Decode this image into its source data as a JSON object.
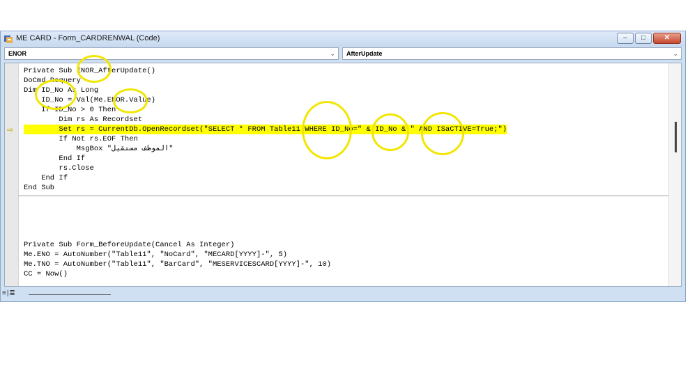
{
  "window": {
    "title": "ME CARD - Form_CARDRENWAL (Code)",
    "buttons": {
      "minimize": "–",
      "maximize": "□",
      "close": "✕"
    }
  },
  "combos": {
    "object": {
      "value": "ENOR",
      "arrow": "⌄"
    },
    "procedure": {
      "value": "AfterUpdate",
      "arrow": "⌄"
    }
  },
  "code_lines": [
    "Private Sub ENOR_AfterUpdate()",
    "DoCmd.Requery",
    "Dim ID_No As Long",
    "    ID_No = Val(Me.ENOR.Value)",
    "    If ID_No > 0 Then",
    "        Dim rs As Recordset",
    "        Set rs = CurrentDb.OpenRecordset(\"SELECT * FROM Table11 WHERE ID_No=\" & ID_No & \" AND ISaCTIVE=True;\")",
    "        If Not rs.EOF Then",
    "            MsgBox \"الموظف مستقيل\"",
    "        End If",
    "        rs.Close",
    "    End If",
    "End Sub",
    "Private Sub Form_BeforeUpdate(Cancel As Integer)",
    "Me.ENO = AutoNumber(\"Table11\", \"NoCard\", \"MECARD[YYYY]-\", 5)",
    "Me.TNO = AutoNumber(\"Table11\", \"BarCard\", \"MESERVICESCARD[YYYY]-\", 10)",
    "CC = Now()"
  ],
  "highlighted_line_index": 6,
  "execution_arrow": "⇨",
  "statusbar": {
    "view_icons": "≡|≣"
  },
  "colors": {
    "highlight": "#ffff00",
    "annotation_circle": "#f2e600",
    "window_frame": "#cfe0f3"
  },
  "icons": [
    "app-icon",
    "minimize-icon",
    "maximize-icon",
    "close-icon",
    "dropdown-arrow-icon",
    "execution-arrow-icon",
    "procedure-view-icon",
    "full-module-view-icon"
  ]
}
